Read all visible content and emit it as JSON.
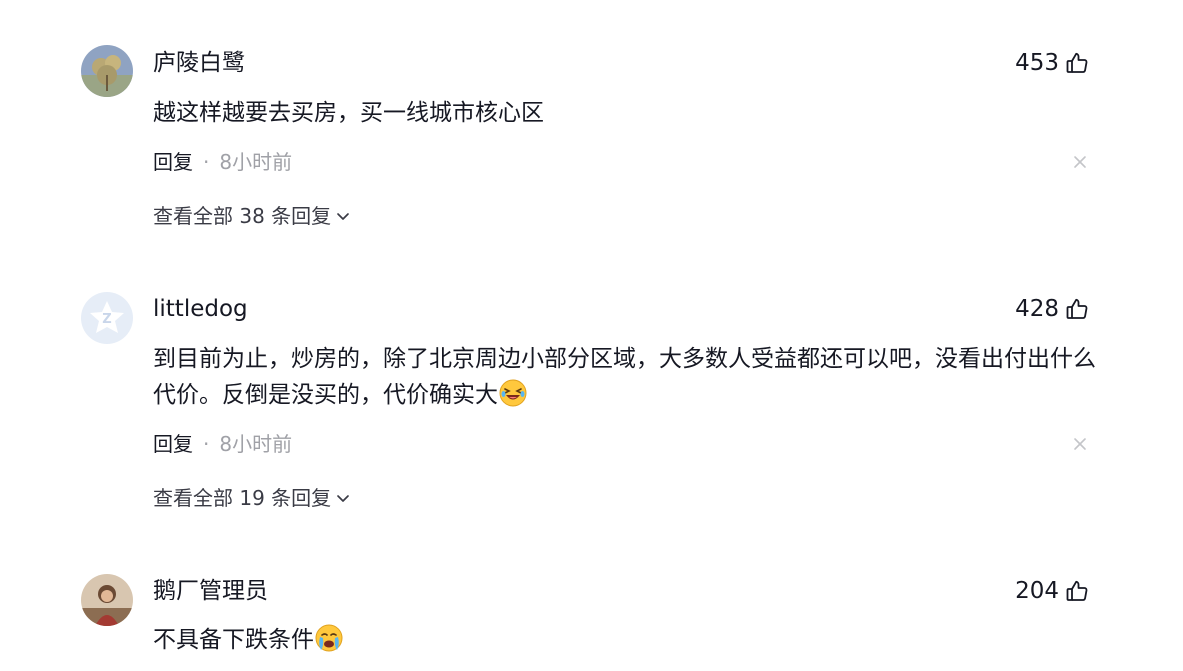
{
  "colors": {
    "text": "#161823",
    "muted": "#a0a1a7",
    "link": "#3a3b45"
  },
  "comments": [
    {
      "username": "庐陵白鹭",
      "likes": "453",
      "content": "越这样越要去买房，买一线城市核心区",
      "reply_label": "回复",
      "separator": "·",
      "time": "8小时前",
      "view_replies": "查看全部 38 条回复",
      "avatar_icon": "tree-photo-avatar"
    },
    {
      "username": "littledog",
      "likes": "428",
      "content": "到目前为止，炒房的，除了北京周边小部分区域，大多数人受益都还可以吧，没看出付出什么代价。反倒是没买的，代价确实大",
      "content_emoji": "laughing-crying-emoji",
      "reply_label": "回复",
      "separator": "·",
      "time": "8小时前",
      "view_replies": "查看全部 19 条回复",
      "avatar_icon": "default-z-avatar"
    },
    {
      "username": "鹅厂管理员",
      "likes": "204",
      "content": "不具备下跌条件",
      "content_emoji": "crying-emoji",
      "avatar_icon": "person-photo-avatar"
    }
  ]
}
